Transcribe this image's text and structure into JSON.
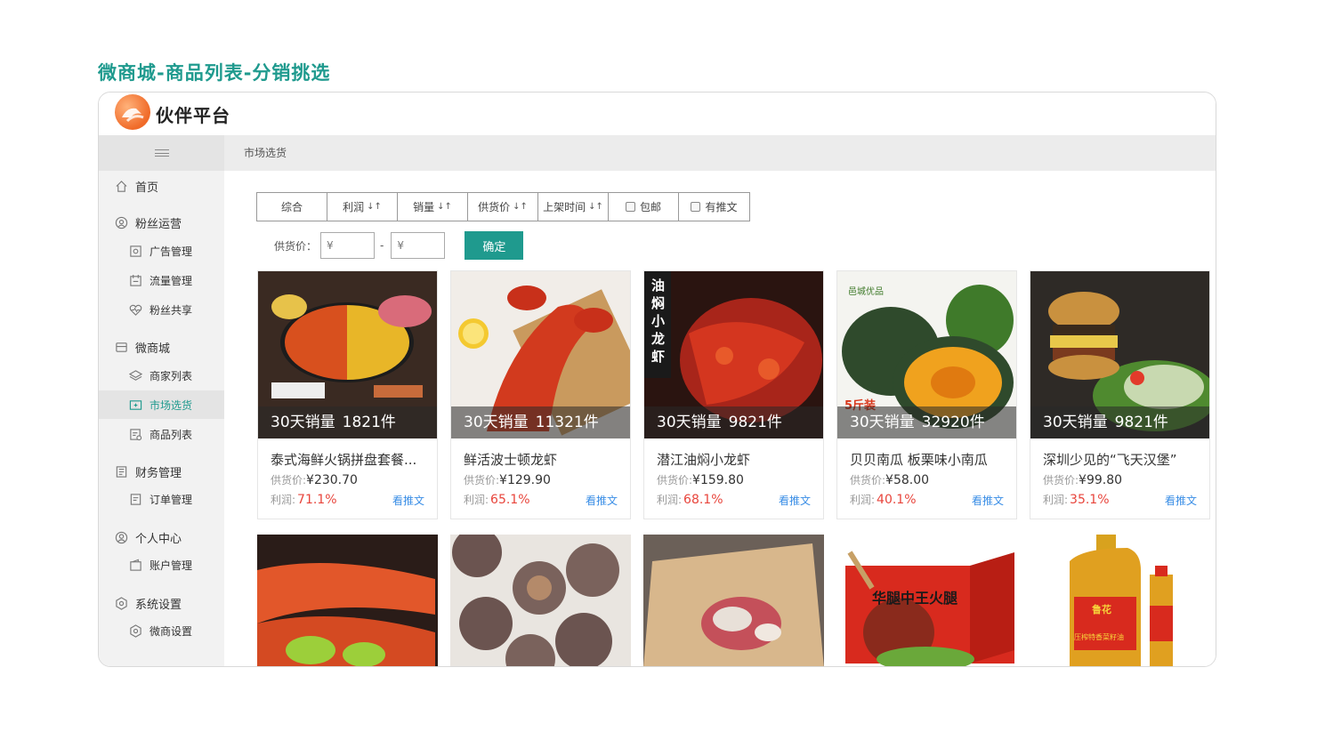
{
  "page_title": "微商城-商品列表-分销挑选",
  "brand": "伙伴平台",
  "breadcrumb": "市场选货",
  "sidebar": {
    "items": [
      {
        "label": "首页",
        "icon": "home-icon"
      },
      {
        "label": "粉丝运营",
        "icon": "fans-icon"
      },
      {
        "label": "广告管理",
        "icon": "ad-icon"
      },
      {
        "label": "流量管理",
        "icon": "traffic-icon"
      },
      {
        "label": "粉丝共享",
        "icon": "heart-pulse-icon"
      },
      {
        "label": "微商城",
        "icon": "shop-icon"
      },
      {
        "label": "商家列表",
        "icon": "layers-icon"
      },
      {
        "label": "市场选货",
        "icon": "market-icon"
      },
      {
        "label": "商品列表",
        "icon": "goods-list-icon"
      },
      {
        "label": "财务管理",
        "icon": "finance-icon"
      },
      {
        "label": "订单管理",
        "icon": "order-icon"
      },
      {
        "label": "个人中心",
        "icon": "user-icon"
      },
      {
        "label": "账户管理",
        "icon": "wallet-icon"
      },
      {
        "label": "系统设置",
        "icon": "settings-icon"
      },
      {
        "label": "微商设置",
        "icon": "shop-settings-icon"
      }
    ]
  },
  "sort": {
    "all": "综合",
    "profit": "利润",
    "sales": "销量",
    "supply_price": "供货价",
    "listed_time": "上架时间",
    "free_shipping": "包邮",
    "has_promo": "有推文",
    "arrows": "↓↑"
  },
  "price_filter": {
    "label": "供货价：",
    "min_placeholder": "¥",
    "max_placeholder": "¥",
    "dash": "-",
    "confirm": "确定"
  },
  "products": [
    {
      "name": "泰式海鲜火锅拼盘套餐...",
      "sales_label": "30天销量",
      "sales": "1821件",
      "price_label": "供货价:",
      "price": "¥230.70",
      "profit_label": "利润:",
      "profit": "71.1%",
      "push": "看推文"
    },
    {
      "name": "鲜活波士顿龙虾",
      "sales_label": "30天销量",
      "sales": "11321件",
      "price_label": "供货价:",
      "price": "¥129.90",
      "profit_label": "利润:",
      "profit": "65.1%",
      "push": "看推文"
    },
    {
      "name": "潜江油焖小龙虾",
      "sales_label": "30天销量",
      "sales": "9821件",
      "price_label": "供货价:",
      "price": "¥159.80",
      "profit_label": "利润:",
      "profit": "68.1%",
      "push": "看推文"
    },
    {
      "name": "贝贝南瓜 板栗味小南瓜",
      "sales_label": "30天销量",
      "sales": "32920件",
      "price_label": "供货价:",
      "price": "¥58.00",
      "profit_label": "利润:",
      "profit": "40.1%",
      "push": "看推文"
    },
    {
      "name": "深圳少见的“飞天汉堡”",
      "sales_label": "30天销量",
      "sales": "9821件",
      "price_label": "供货价:",
      "price": "¥99.80",
      "profit_label": "利润:",
      "profit": "35.1%",
      "push": "看推文"
    }
  ],
  "image_texts": {
    "crayfish_vertical": "油焖小龙虾",
    "pumpkin_brand": "邑城优品",
    "pumpkin_badge": "5斤装",
    "ham_box": "华腿中王火腿",
    "oil_brand": "鲁花",
    "oil_label": "压榨特香菜籽油"
  },
  "colors": {
    "accent": "#1f9a8e",
    "profit": "#e8453c",
    "link": "#3a8ee6"
  }
}
